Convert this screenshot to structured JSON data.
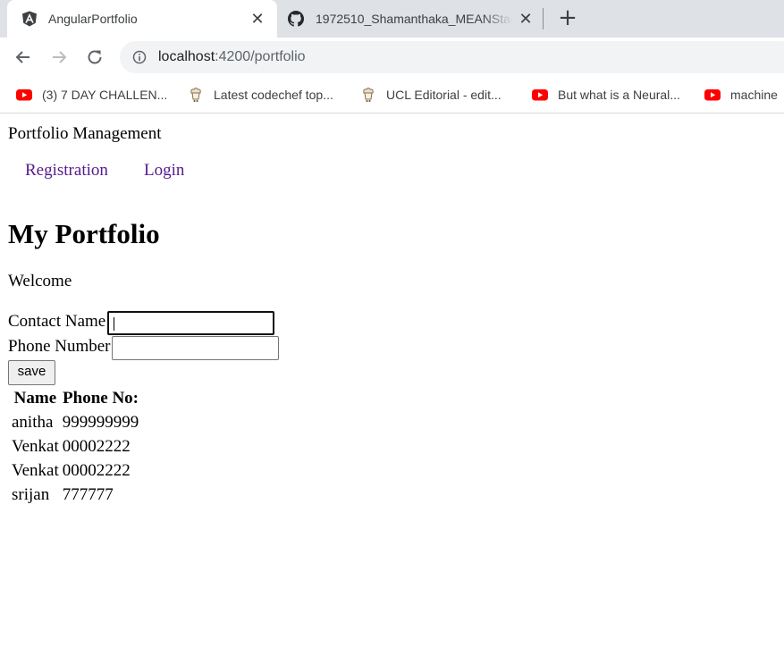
{
  "browser": {
    "tabs": [
      {
        "title": "AngularPortfolio",
        "icon": "angular-icon",
        "active": true
      },
      {
        "title": "1972510_Shamanthaka_MEANStack",
        "icon": "github-icon",
        "active": false
      }
    ],
    "address": {
      "host": "localhost",
      "path": ":4200/portfolio"
    },
    "bookmarks": [
      {
        "label": "(3) 7 DAY CHALLEN...",
        "icon": "youtube-icon"
      },
      {
        "label": "Latest codechef top...",
        "icon": "codechef-icon"
      },
      {
        "label": "UCL Editorial - edit...",
        "icon": "codechef-icon"
      },
      {
        "label": "But what is a Neural...",
        "icon": "youtube-icon"
      },
      {
        "label": "machine",
        "icon": "youtube-icon"
      }
    ]
  },
  "page": {
    "brand": "Portfolio Management",
    "nav": {
      "registration": "Registration",
      "login": "Login"
    },
    "heading": "My Portfolio",
    "welcome": "Welcome",
    "form": {
      "contact_label": "Contact Name",
      "contact_value": "",
      "phone_label": "Phone Number",
      "phone_value": "",
      "save_label": "save"
    },
    "table": {
      "headers": [
        "Name",
        "Phone No:"
      ],
      "rows": [
        [
          "anitha",
          "999999999"
        ],
        [
          "Venkat",
          "00002222"
        ],
        [
          "Venkat",
          "00002222"
        ],
        [
          "srijan",
          "777777"
        ]
      ]
    }
  },
  "colors": {
    "link": "#551a8b",
    "youtube_red": "#ff0000",
    "tabstrip": "#dee1e6"
  }
}
